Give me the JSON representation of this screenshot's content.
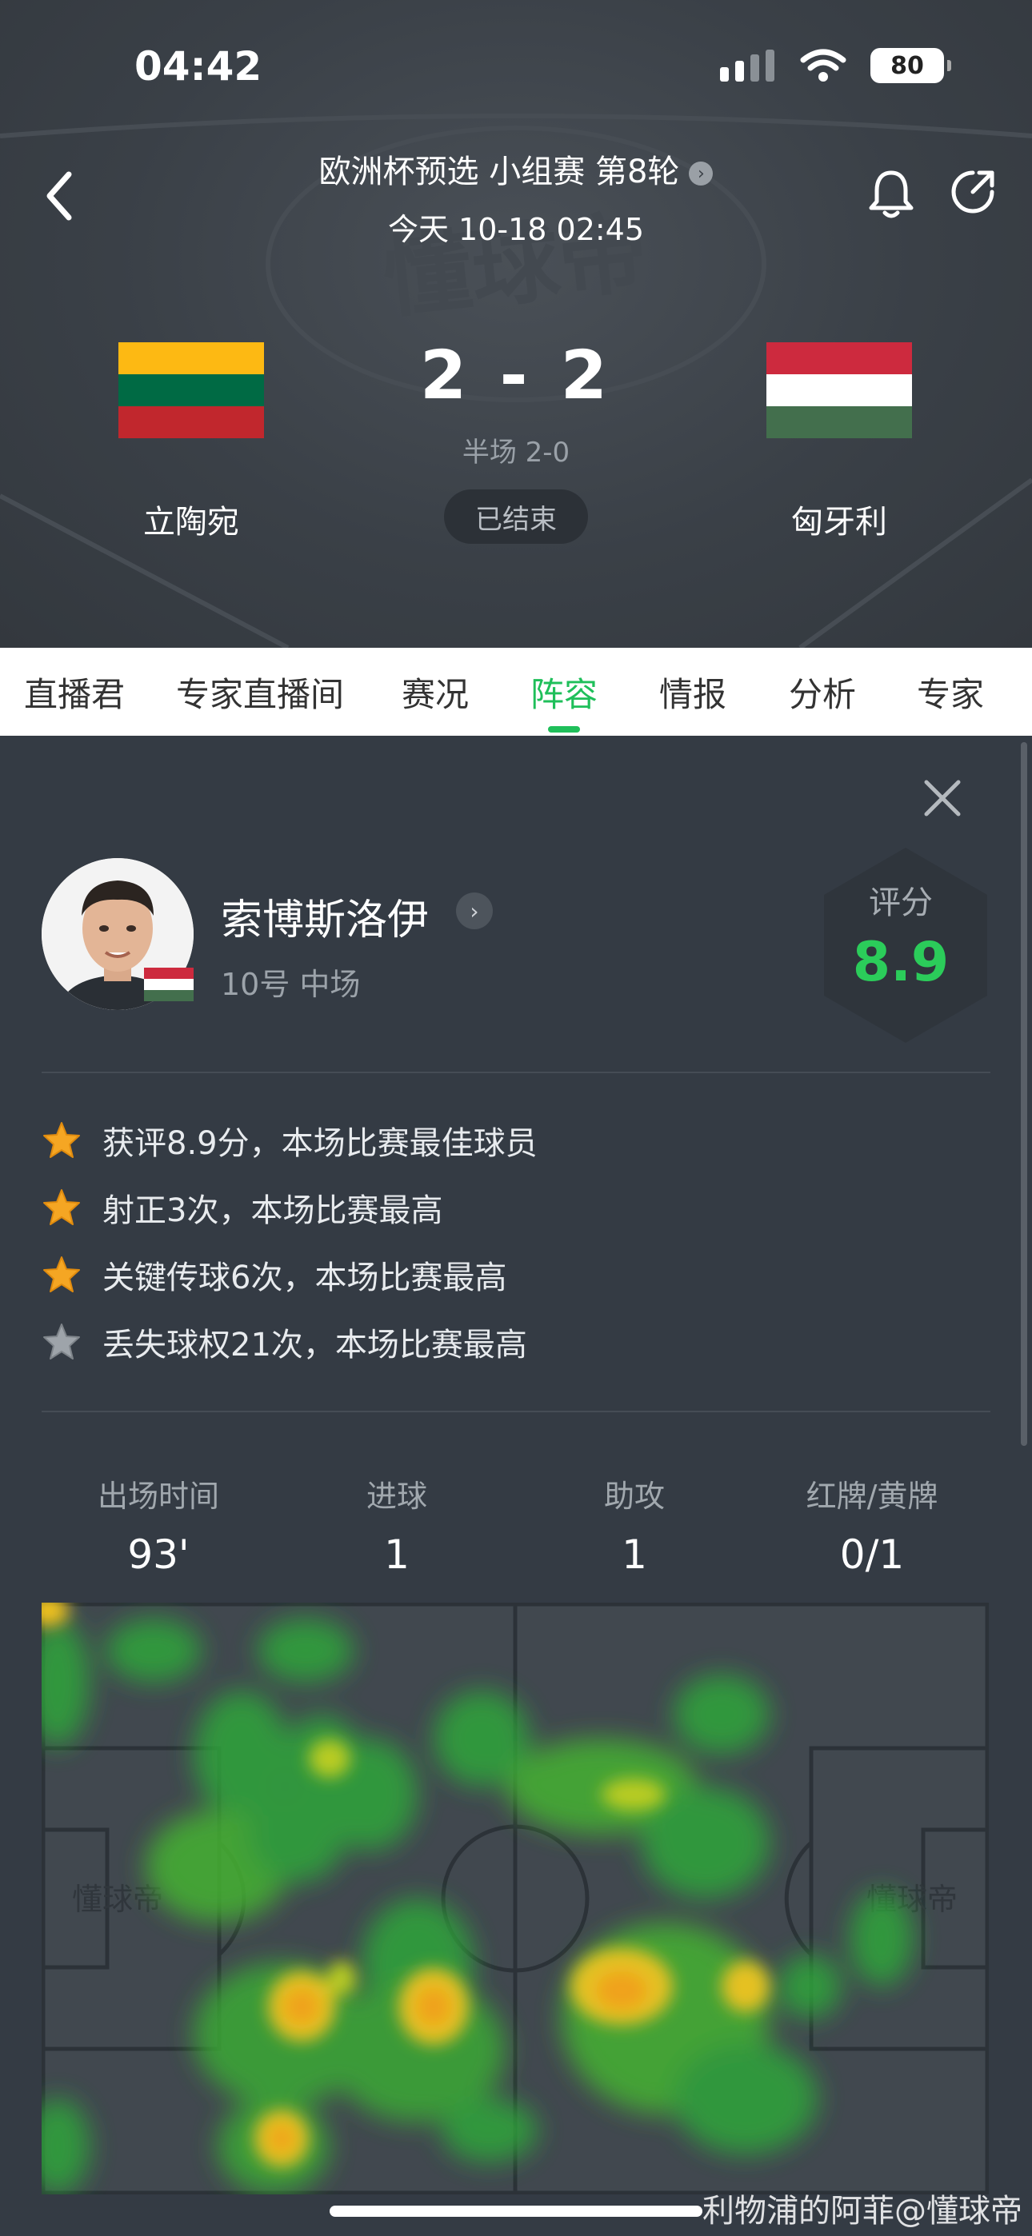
{
  "status_bar": {
    "time": "04:42",
    "battery": "80"
  },
  "match": {
    "competition": "欧洲杯预选 小组赛 第8轮",
    "kickoff": "今天 10-18 02:45",
    "home_team": "立陶宛",
    "away_team": "匈牙利",
    "score": "2 - 2",
    "halftime": "半场 2-0",
    "status": "已结束",
    "home_flag_colors": [
      "#FDB913",
      "#006A44",
      "#C1272D"
    ],
    "away_flag_colors": [
      "#CD2A3E",
      "#FFFFFF",
      "#436F4D"
    ]
  },
  "tabs": [
    {
      "label": "直播君",
      "active": false
    },
    {
      "label": "专家直播间",
      "active": false
    },
    {
      "label": "赛况",
      "active": false
    },
    {
      "label": "阵容",
      "active": true
    },
    {
      "label": "情报",
      "active": false
    },
    {
      "label": "分析",
      "active": false
    },
    {
      "label": "专家",
      "active": false
    }
  ],
  "player": {
    "name": "索博斯洛伊",
    "number_position": "10号 中场",
    "rating_label": "评分",
    "rating": "8.9"
  },
  "highlights": [
    {
      "text": "获评8.9分，本场比赛最佳球员",
      "star": "gold"
    },
    {
      "text": "射正3次，本场比赛最高",
      "star": "gold"
    },
    {
      "text": "关键传球6次，本场比赛最高",
      "star": "gold"
    },
    {
      "text": "丢失球权21次，本场比赛最高",
      "star": "silver"
    }
  ],
  "stats": [
    {
      "label": "出场时间",
      "value": "93'"
    },
    {
      "label": "进球",
      "value": "1"
    },
    {
      "label": "助攻",
      "value": "1"
    },
    {
      "label": "红牌/黄牌",
      "value": "0/1"
    }
  ],
  "pitch": {
    "brand_left": "懂球帝",
    "brand_right": "懂球帝"
  },
  "header_brand": "懂球帝",
  "watermark": "利物浦的阿菲@懂球帝",
  "colors": {
    "accent": "#1fbf5a",
    "rating": "#2bcc5a",
    "gold_star": "#f5a623",
    "silver_star": "#9ea4aa"
  }
}
